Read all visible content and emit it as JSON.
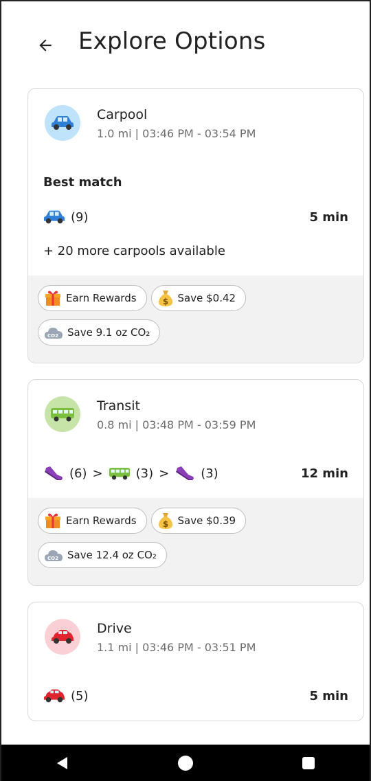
{
  "header": {
    "title": "Explore Options",
    "back_icon": "arrow-left-icon"
  },
  "options": [
    {
      "mode": "Carpool",
      "summary": "1.0 mi | 03:46 PM - 03:54 PM",
      "best_match_label": "Best match",
      "route_count": "(9)",
      "duration": "5 min",
      "more": "+ 20 more carpools available",
      "chips": {
        "rewards": "Earn Rewards",
        "save_money": "Save $0.42",
        "save_co2": "Save 9.1 oz CO₂"
      }
    },
    {
      "mode": "Transit",
      "summary": "0.8 mi | 03:48 PM - 03:59 PM",
      "route": {
        "walk1": "(6)",
        "sep1": ">",
        "bus": "(3)",
        "sep2": ">",
        "walk2": "(3)"
      },
      "duration": "12 min",
      "chips": {
        "rewards": "Earn Rewards",
        "save_money": "Save $0.39",
        "save_co2": "Save 12.4 oz CO₂"
      }
    },
    {
      "mode": "Drive",
      "summary": "1.1 mi | 03:46 PM - 03:51 PM",
      "route_count": "(5)",
      "duration": "5 min"
    }
  ],
  "colors": {
    "carpool_bg": "#bfe3fb",
    "transit_bg": "#c6e3a8",
    "drive_bg": "#fbd0d4",
    "car_blue": "#2f7fd6",
    "car_red": "#e0252f",
    "bus_green": "#7bbf3f",
    "shoe_purple": "#8a3fb8"
  }
}
